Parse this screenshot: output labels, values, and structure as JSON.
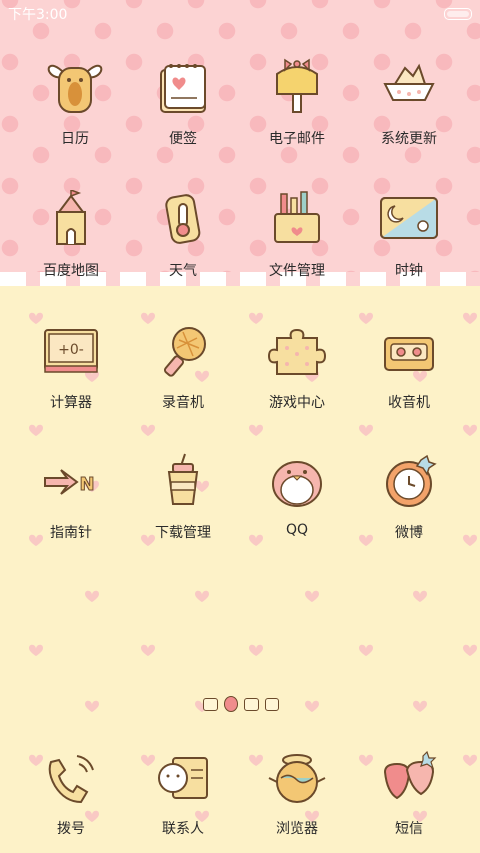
{
  "status_bar": {
    "time": "下午3:00"
  },
  "row1": [
    {
      "label": "日历",
      "icon": "calendar-winged-icon"
    },
    {
      "label": "便签",
      "icon": "notepad-icon"
    },
    {
      "label": "电子邮件",
      "icon": "mailbox-icon"
    },
    {
      "label": "系统更新",
      "icon": "paper-boat-icon"
    }
  ],
  "row2": [
    {
      "label": "百度地图",
      "icon": "castle-icon"
    },
    {
      "label": "天气",
      "icon": "thermometer-icon"
    },
    {
      "label": "文件管理",
      "icon": "pencil-box-icon"
    },
    {
      "label": "时钟",
      "icon": "moon-sun-icon"
    }
  ],
  "row3": [
    {
      "label": "计算器",
      "icon": "calculator-icon"
    },
    {
      "label": "录音机",
      "icon": "microphone-icon"
    },
    {
      "label": "游戏中心",
      "icon": "puzzle-icon"
    },
    {
      "label": "收音机",
      "icon": "cassette-icon"
    }
  ],
  "row4": [
    {
      "label": "指南针",
      "icon": "compass-arrow-icon"
    },
    {
      "label": "下载管理",
      "icon": "drink-cup-icon"
    },
    {
      "label": "QQ",
      "icon": "penguin-icon"
    },
    {
      "label": "微博",
      "icon": "clock-ring-icon"
    }
  ],
  "dock": [
    {
      "label": "拨号",
      "icon": "phone-handset-icon"
    },
    {
      "label": "联系人",
      "icon": "contact-card-icon"
    },
    {
      "label": "浏览器",
      "icon": "globe-pot-icon"
    },
    {
      "label": "短信",
      "icon": "strawberry-icon"
    }
  ],
  "colors": {
    "top_bg": "#fcd3d3",
    "bottom_bg": "#fdf2c8",
    "accent": "#f08c8c",
    "outline": "#6b4a2b"
  },
  "page_indicator": {
    "pages": 4,
    "current": 2
  }
}
